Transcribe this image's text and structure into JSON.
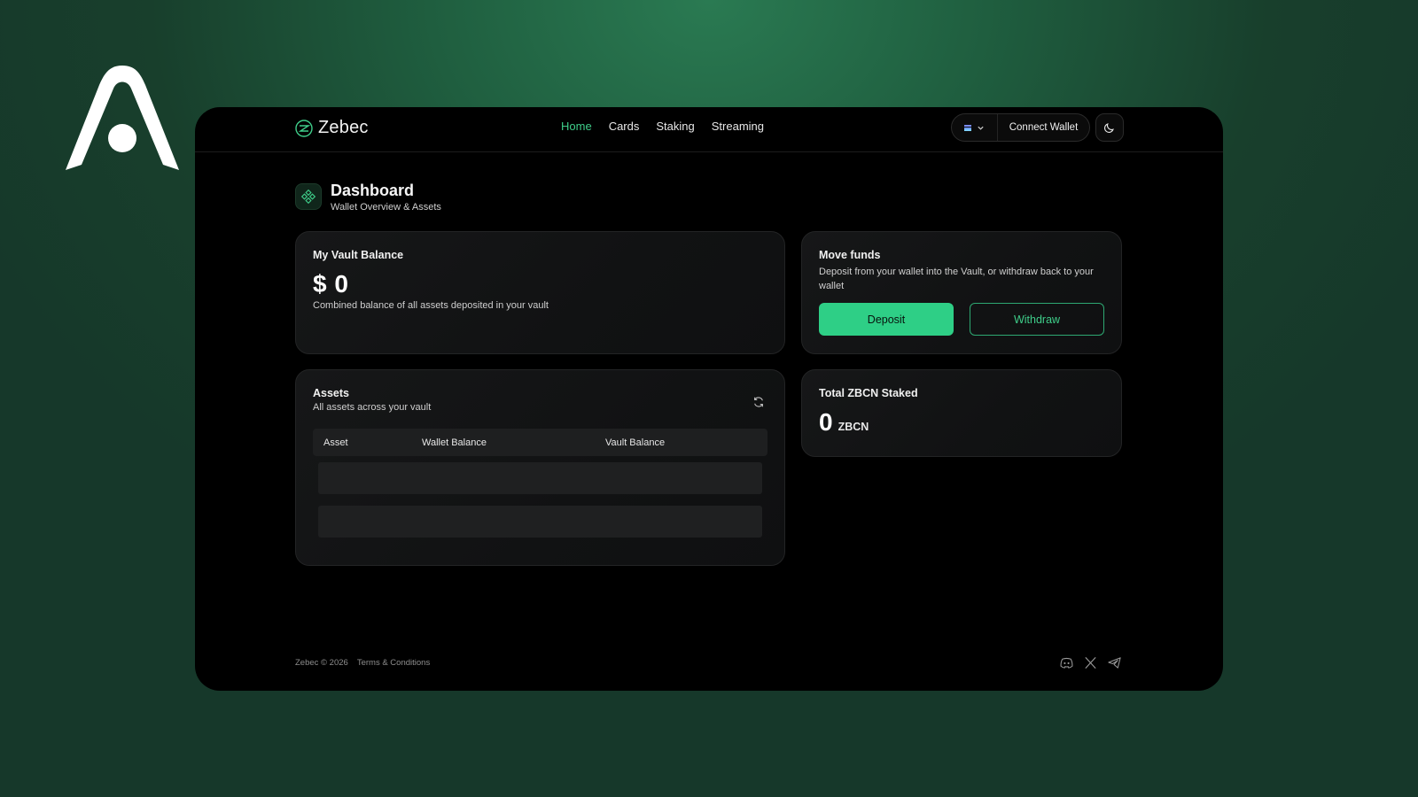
{
  "app": {
    "name": "Zebec"
  },
  "nav": {
    "items": [
      {
        "label": "Home",
        "active": true
      },
      {
        "label": "Cards",
        "active": false
      },
      {
        "label": "Staking",
        "active": false
      },
      {
        "label": "Streaming",
        "active": false
      }
    ]
  },
  "header": {
    "connect_label": "Connect Wallet",
    "network_icon": "network-icon",
    "theme_icon": "moon-icon"
  },
  "page": {
    "title": "Dashboard",
    "subtitle": "Wallet Overview & Assets",
    "icon": "dashboard-icon"
  },
  "vault": {
    "title": "My Vault Balance",
    "amount": "$ 0",
    "description": "Combined balance of all assets deposited in your vault"
  },
  "move_funds": {
    "title": "Move funds",
    "description": "Deposit from your wallet into the Vault, or withdraw back to your wallet",
    "deposit_label": "Deposit",
    "withdraw_label": "Withdraw"
  },
  "assets": {
    "title": "Assets",
    "subtitle": "All assets across your vault",
    "columns": [
      "Asset",
      "Wallet Balance",
      "Vault Balance"
    ],
    "rows": []
  },
  "staked": {
    "title": "Total ZBCN Staked",
    "value": "0",
    "unit": "ZBCN"
  },
  "footer": {
    "copyright": "Zebec © 2026",
    "terms_label": "Terms & Conditions",
    "social_icons": [
      "discord-icon",
      "x-icon",
      "telegram-icon"
    ]
  },
  "colors": {
    "accent": "#2ecf86",
    "accent_text": "#3fce8a",
    "background": "#000000"
  }
}
